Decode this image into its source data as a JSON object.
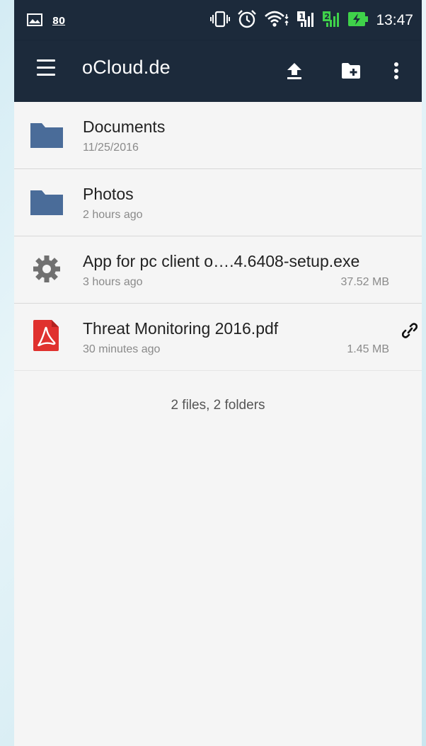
{
  "status_bar": {
    "time": "13:47",
    "badge_number": "80",
    "icons": [
      "image-notification-icon",
      "vibrate-icon",
      "alarm-icon",
      "wifi-icon",
      "signal-sim1-icon",
      "signal-sim2-icon",
      "battery-charging-icon"
    ],
    "sim2_label": "2"
  },
  "app_bar": {
    "title": "oCloud.de",
    "actions": [
      "menu-icon",
      "upload-icon",
      "new-folder-icon",
      "more-options-icon"
    ]
  },
  "files": [
    {
      "type": "folder",
      "name": "Documents",
      "meta": "11/25/2016",
      "size": "",
      "shared": false
    },
    {
      "type": "folder",
      "name": "Photos",
      "meta": "2 hours ago",
      "size": "",
      "shared": false
    },
    {
      "type": "executable",
      "name": "App for pc client o….4.6408-setup.exe",
      "meta": "3 hours ago",
      "size": "37.52 MB",
      "shared": false
    },
    {
      "type": "pdf",
      "name": "Threat Monitoring 2016.pdf",
      "meta": "30 minutes ago",
      "size": "1.45 MB",
      "shared": true
    }
  ],
  "summary": "2 files, 2 folders",
  "colors": {
    "toolbar": "#1c2a3b",
    "folder": "#4a6c99",
    "pdf": "#e0312e",
    "gear": "#707070",
    "background": "#f5f5f5"
  }
}
